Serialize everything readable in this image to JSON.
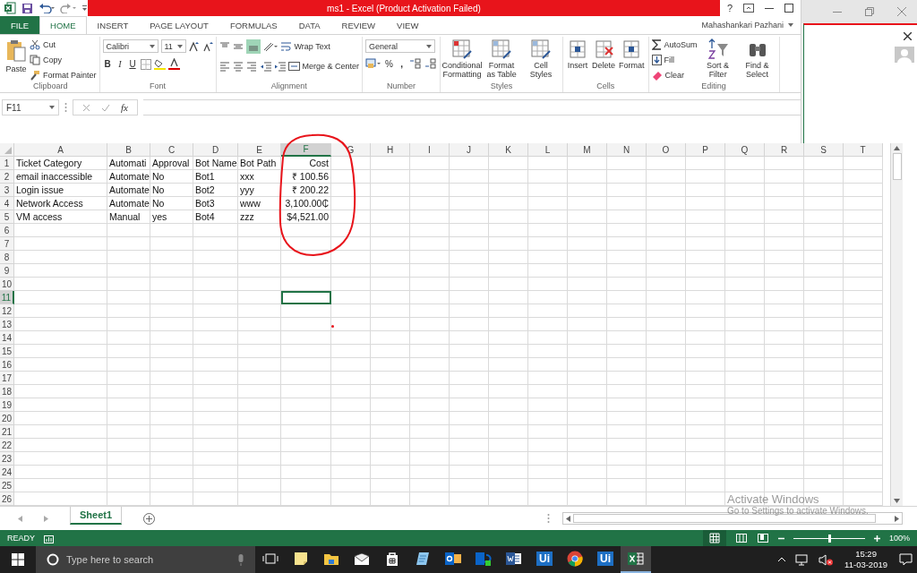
{
  "window": {
    "title": "ms1 - Excel (Product Activation Failed)",
    "help": "?",
    "user": "Mahashankari Pazhani"
  },
  "ribbon_tabs": [
    {
      "label": "FILE",
      "kind": "file",
      "selected": false
    },
    {
      "label": "HOME",
      "kind": "tab",
      "selected": true
    },
    {
      "label": "INSERT",
      "kind": "tab",
      "selected": false
    },
    {
      "label": "PAGE LAYOUT",
      "kind": "tab",
      "selected": false
    },
    {
      "label": "FORMULAS",
      "kind": "tab",
      "selected": false
    },
    {
      "label": "DATA",
      "kind": "tab",
      "selected": false
    },
    {
      "label": "REVIEW",
      "kind": "tab",
      "selected": false
    },
    {
      "label": "VIEW",
      "kind": "tab",
      "selected": false
    }
  ],
  "clipboard": {
    "label": "Clipboard",
    "paste": "Paste",
    "cut": "Cut",
    "copy": "Copy",
    "format_painter": "Format Painter"
  },
  "font": {
    "label": "Font",
    "name": "Calibri",
    "size": "11",
    "bold": "B",
    "italic": "I",
    "underline": "U"
  },
  "alignment": {
    "label": "Alignment",
    "wrap_text": "Wrap Text",
    "merge_center": "Merge & Center"
  },
  "number": {
    "label": "Number",
    "format": "General",
    "percent": "%",
    "comma": ","
  },
  "styles": {
    "label": "Styles",
    "buttons": [
      "Conditional Formatting",
      "Format as Table",
      "Cell Styles"
    ]
  },
  "cells": {
    "label": "Cells",
    "buttons": [
      "Insert",
      "Delete",
      "Format"
    ]
  },
  "editing": {
    "label": "Editing",
    "autosum": "AutoSum",
    "fill": "Fill",
    "clear": "Clear",
    "sort_filter": "Sort & Filter",
    "find_select": "Find & Select"
  },
  "formula_bar": {
    "name_box": "F11",
    "function_label": "fx"
  },
  "sheet": {
    "columns": [
      {
        "letter": "A",
        "selected": false,
        "numeric": false
      },
      {
        "letter": "B",
        "selected": false,
        "numeric": false
      },
      {
        "letter": "C",
        "selected": false,
        "numeric": false
      },
      {
        "letter": "D",
        "selected": false,
        "numeric": false
      },
      {
        "letter": "E",
        "selected": false,
        "numeric": false
      },
      {
        "letter": "F",
        "selected": true,
        "numeric": true
      },
      {
        "letter": "G",
        "selected": false
      },
      {
        "letter": "H",
        "selected": false
      },
      {
        "letter": "I",
        "selected": false
      },
      {
        "letter": "J",
        "selected": false
      },
      {
        "letter": "K",
        "selected": false
      },
      {
        "letter": "L",
        "selected": false
      },
      {
        "letter": "M",
        "selected": false
      },
      {
        "letter": "N",
        "selected": false
      },
      {
        "letter": "O",
        "selected": false
      },
      {
        "letter": "P",
        "selected": false
      },
      {
        "letter": "Q",
        "selected": false
      },
      {
        "letter": "R",
        "selected": false
      },
      {
        "letter": "S",
        "selected": false
      },
      {
        "letter": "T",
        "selected": false
      }
    ],
    "rows": [
      {
        "number": "1",
        "selected": false,
        "cells": [
          "Ticket Category",
          "Automati",
          "Approval",
          "Bot Name",
          "Bot Path",
          "Cost"
        ]
      },
      {
        "number": "2",
        "selected": false,
        "cells": [
          "email inaccessible",
          "Automate",
          "No",
          "Bot1",
          "xxx",
          "₹ 100.56"
        ]
      },
      {
        "number": "3",
        "selected": false,
        "cells": [
          "Login issue",
          "Automate",
          "No",
          "Bot2",
          "yyy",
          "₹ 200.22"
        ]
      },
      {
        "number": "4",
        "selected": false,
        "cells": [
          "Network Access",
          "Automate",
          "No",
          "Bot3",
          "www",
          "3,100.00₵"
        ]
      },
      {
        "number": "5",
        "selected": false,
        "cells": [
          "VM access",
          "Manual",
          "yes",
          "Bot4",
          "zzz",
          "$4,521.00"
        ]
      },
      {
        "number": "6",
        "selected": false
      },
      {
        "number": "7",
        "selected": false
      },
      {
        "number": "8",
        "selected": false
      },
      {
        "number": "9",
        "selected": false
      },
      {
        "number": "10",
        "selected": false
      },
      {
        "number": "11",
        "selected": true
      },
      {
        "number": "12",
        "selected": false
      },
      {
        "number": "13",
        "selected": false
      },
      {
        "number": "14",
        "selected": false
      },
      {
        "number": "15",
        "selected": false
      },
      {
        "number": "16",
        "selected": false
      },
      {
        "number": "17",
        "selected": false
      },
      {
        "number": "18",
        "selected": false
      },
      {
        "number": "19",
        "selected": false
      },
      {
        "number": "20",
        "selected": false
      },
      {
        "number": "21",
        "selected": false
      },
      {
        "number": "22",
        "selected": false
      },
      {
        "number": "23",
        "selected": false
      },
      {
        "number": "24",
        "selected": false
      },
      {
        "number": "25",
        "selected": false
      },
      {
        "number": "26",
        "selected": false
      }
    ]
  },
  "sheet_tabs": [
    {
      "label": "Sheet1",
      "selected": true
    }
  ],
  "status_bar": {
    "mode": "READY",
    "zoom_slider": {
      "level": 0.5
    },
    "zoom": "100%"
  },
  "activation_notice": {
    "title": "Activate Windows",
    "message": "Go to Settings to activate Windows."
  },
  "taskbar": {
    "search_placeholder": "Type here to search",
    "apps": [
      {
        "kind": "task-view",
        "selected": false
      },
      {
        "kind": "note",
        "selected": false
      },
      {
        "kind": "folder",
        "selected": false
      },
      {
        "kind": "mail",
        "selected": false
      },
      {
        "kind": "store",
        "selected": false
      },
      {
        "kind": "notepad",
        "selected": false
      },
      {
        "kind": "outlook",
        "selected": false
      },
      {
        "kind": "lync",
        "selected": false
      },
      {
        "kind": "word",
        "selected": false
      },
      {
        "kind": "tile",
        "label": "Ui",
        "selected": false
      },
      {
        "kind": "chrome",
        "selected": false
      },
      {
        "kind": "tile",
        "label": "Ui",
        "selected": false
      },
      {
        "kind": "excel",
        "selected": true
      }
    ],
    "time": "15:29",
    "date": "11-03-2019"
  }
}
